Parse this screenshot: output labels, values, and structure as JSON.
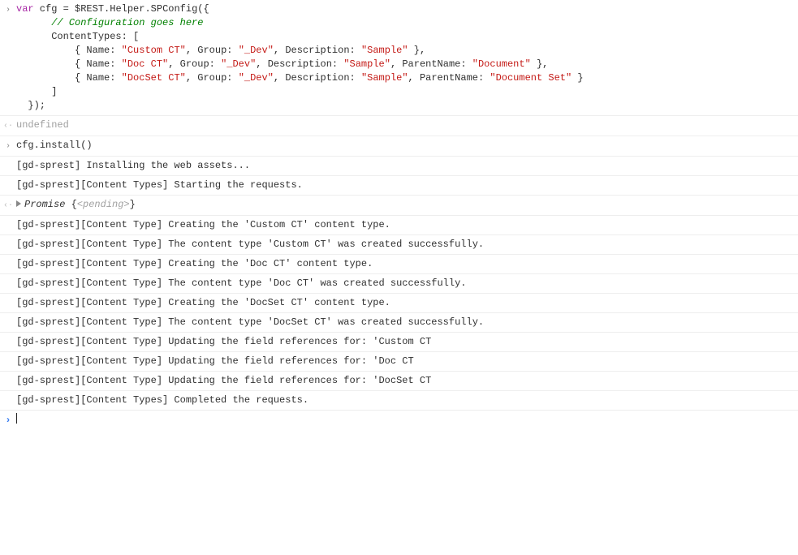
{
  "code_tokens": [
    [
      {
        "t": "var",
        "c": "kw"
      },
      {
        "t": " cfg "
      },
      {
        "t": "="
      },
      {
        "t": " $REST"
      },
      {
        "t": "."
      },
      {
        "t": "Helper"
      },
      {
        "t": "."
      },
      {
        "t": "SPConfig"
      },
      {
        "t": "({"
      }
    ],
    [
      {
        "t": "      "
      },
      {
        "t": "// Configuration goes here",
        "c": "cmt"
      }
    ],
    [
      {
        "t": "      ContentTypes"
      },
      {
        "t": ": ["
      }
    ],
    [
      {
        "t": "          { "
      },
      {
        "t": "Name"
      },
      {
        "t": ": "
      },
      {
        "t": "\"Custom CT\"",
        "c": "str"
      },
      {
        "t": ", "
      },
      {
        "t": "Group"
      },
      {
        "t": ": "
      },
      {
        "t": "\"_Dev\"",
        "c": "str"
      },
      {
        "t": ", "
      },
      {
        "t": "Description"
      },
      {
        "t": ": "
      },
      {
        "t": "\"Sample\"",
        "c": "str"
      },
      {
        "t": " },"
      }
    ],
    [
      {
        "t": "          { "
      },
      {
        "t": "Name"
      },
      {
        "t": ": "
      },
      {
        "t": "\"Doc CT\"",
        "c": "str"
      },
      {
        "t": ", "
      },
      {
        "t": "Group"
      },
      {
        "t": ": "
      },
      {
        "t": "\"_Dev\"",
        "c": "str"
      },
      {
        "t": ", "
      },
      {
        "t": "Description"
      },
      {
        "t": ": "
      },
      {
        "t": "\"Sample\"",
        "c": "str"
      },
      {
        "t": ", "
      },
      {
        "t": "ParentName"
      },
      {
        "t": ": "
      },
      {
        "t": "\"Document\"",
        "c": "str"
      },
      {
        "t": " },"
      }
    ],
    [
      {
        "t": "          { "
      },
      {
        "t": "Name"
      },
      {
        "t": ": "
      },
      {
        "t": "\"DocSet CT\"",
        "c": "str"
      },
      {
        "t": ", "
      },
      {
        "t": "Group"
      },
      {
        "t": ": "
      },
      {
        "t": "\"_Dev\"",
        "c": "str"
      },
      {
        "t": ", "
      },
      {
        "t": "Description"
      },
      {
        "t": ": "
      },
      {
        "t": "\"Sample\"",
        "c": "str"
      },
      {
        "t": ", "
      },
      {
        "t": "ParentName"
      },
      {
        "t": ": "
      },
      {
        "t": "\"Document Set\"",
        "c": "str"
      },
      {
        "t": " }"
      }
    ],
    [
      {
        "t": "      ]"
      }
    ],
    [
      {
        "t": "  });"
      }
    ]
  ],
  "undefined_label": "undefined",
  "input2_tokens": [
    [
      {
        "t": "cfg"
      },
      {
        "t": "."
      },
      {
        "t": "install"
      },
      {
        "t": "()"
      }
    ]
  ],
  "promise_prefix": "Promise ",
  "promise_body_open": "{",
  "promise_state": "<pending>",
  "promise_body_close": "}",
  "logs": [
    "[gd-sprest] Installing the web assets...",
    "[gd-sprest][Content Types] Starting the requests.",
    "[gd-sprest][Content Type] Creating the 'Custom CT' content type.",
    "[gd-sprest][Content Type] The content type 'Custom CT' was created successfully.",
    "[gd-sprest][Content Type] Creating the 'Doc CT' content type.",
    "[gd-sprest][Content Type] The content type 'Doc CT' was created successfully.",
    "[gd-sprest][Content Type] Creating the 'DocSet CT' content type.",
    "[gd-sprest][Content Type] The content type 'DocSet CT' was created successfully.",
    "[gd-sprest][Content Type] Updating the field references for: 'Custom CT",
    "[gd-sprest][Content Type] Updating the field references for: 'Doc CT",
    "[gd-sprest][Content Type] Updating the field references for: 'DocSet CT",
    "[gd-sprest][Content Types] Completed the requests."
  ],
  "glyphs": {
    "input": ">",
    "output": "‹·"
  }
}
